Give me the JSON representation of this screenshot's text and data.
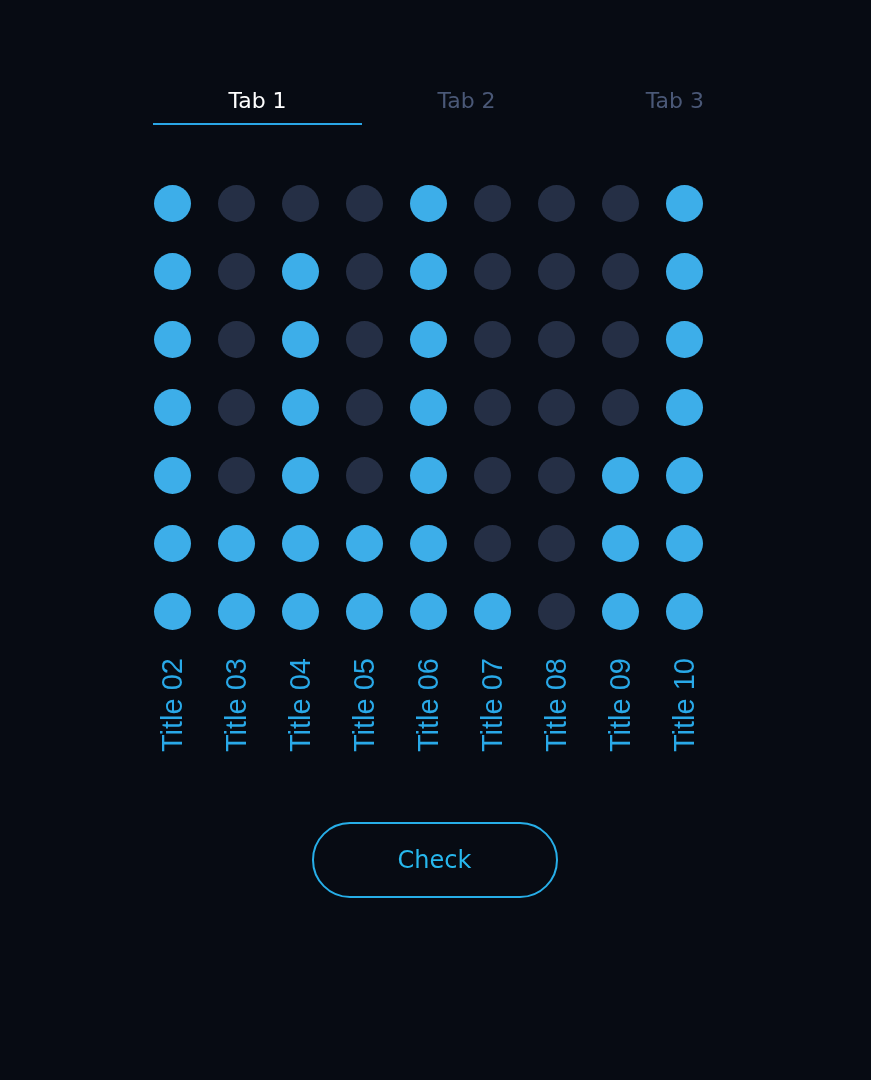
{
  "tabs": [
    {
      "label": "Tab 1",
      "selected": true
    },
    {
      "label": "Tab 2",
      "selected": false
    },
    {
      "label": "Tab 3",
      "selected": false
    }
  ],
  "columns": [
    {
      "label": "Title 02",
      "dots": [
        {
          "on": true
        },
        {
          "on": true
        },
        {
          "on": true
        },
        {
          "on": true
        },
        {
          "on": true
        },
        {
          "on": true
        },
        {
          "on": true
        }
      ]
    },
    {
      "label": "Title 03",
      "dots": [
        {
          "on": false
        },
        {
          "on": false
        },
        {
          "on": false
        },
        {
          "on": false
        },
        {
          "on": false
        },
        {
          "on": true
        },
        {
          "on": true
        }
      ]
    },
    {
      "label": "Title 04",
      "dots": [
        {
          "on": false
        },
        {
          "on": true
        },
        {
          "on": true
        },
        {
          "on": true
        },
        {
          "on": true
        },
        {
          "on": true
        },
        {
          "on": true
        }
      ]
    },
    {
      "label": "Title 05",
      "dots": [
        {
          "on": false
        },
        {
          "on": false
        },
        {
          "on": false
        },
        {
          "on": false
        },
        {
          "on": false
        },
        {
          "on": true
        },
        {
          "on": true
        }
      ]
    },
    {
      "label": "Title 06",
      "dots": [
        {
          "on": true
        },
        {
          "on": true
        },
        {
          "on": true
        },
        {
          "on": true
        },
        {
          "on": true
        },
        {
          "on": true
        },
        {
          "on": true
        }
      ]
    },
    {
      "label": "Title 07",
      "dots": [
        {
          "on": false
        },
        {
          "on": false
        },
        {
          "on": false
        },
        {
          "on": false
        },
        {
          "on": false
        },
        {
          "on": false
        },
        {
          "on": true
        }
      ]
    },
    {
      "label": "Title 08",
      "dots": [
        {
          "on": false
        },
        {
          "on": false
        },
        {
          "on": false
        },
        {
          "on": false
        },
        {
          "on": false
        },
        {
          "on": false
        },
        {
          "on": false
        }
      ]
    },
    {
      "label": "Title 09",
      "dots": [
        {
          "on": false
        },
        {
          "on": false
        },
        {
          "on": false
        },
        {
          "on": false
        },
        {
          "on": true
        },
        {
          "on": true
        },
        {
          "on": true
        }
      ]
    },
    {
      "label": "Title 10",
      "dots": [
        {
          "on": true
        },
        {
          "on": true
        },
        {
          "on": true
        },
        {
          "on": true
        },
        {
          "on": true
        },
        {
          "on": true
        },
        {
          "on": true
        }
      ]
    }
  ],
  "button": {
    "label": "Check"
  }
}
